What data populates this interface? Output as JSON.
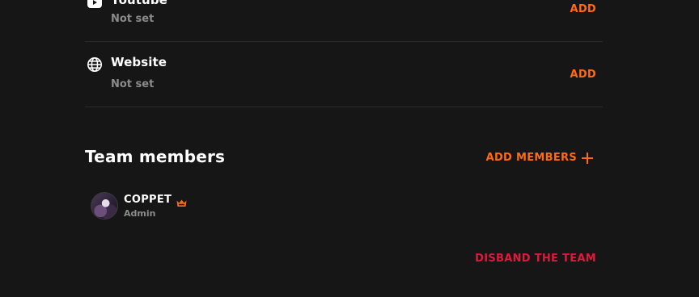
{
  "social_links": [
    {
      "icon": "youtube-icon",
      "title": "Youtube",
      "value": "Not set",
      "action": "ADD"
    },
    {
      "icon": "globe-icon",
      "title": "Website",
      "value": "Not set",
      "action": "ADD"
    }
  ],
  "team": {
    "title": "Team members",
    "add_members_label": "ADD MEMBERS",
    "members": [
      {
        "name": "COPPET",
        "role": "Admin",
        "badge": "crown-icon"
      }
    ],
    "disband_label": "DISBAND THE TEAM"
  },
  "colors": {
    "background": "#161616",
    "accent": "#ff6a13",
    "danger": "#e0193d",
    "muted_text": "#8b8b8b",
    "divider": "#2c2c2c"
  }
}
